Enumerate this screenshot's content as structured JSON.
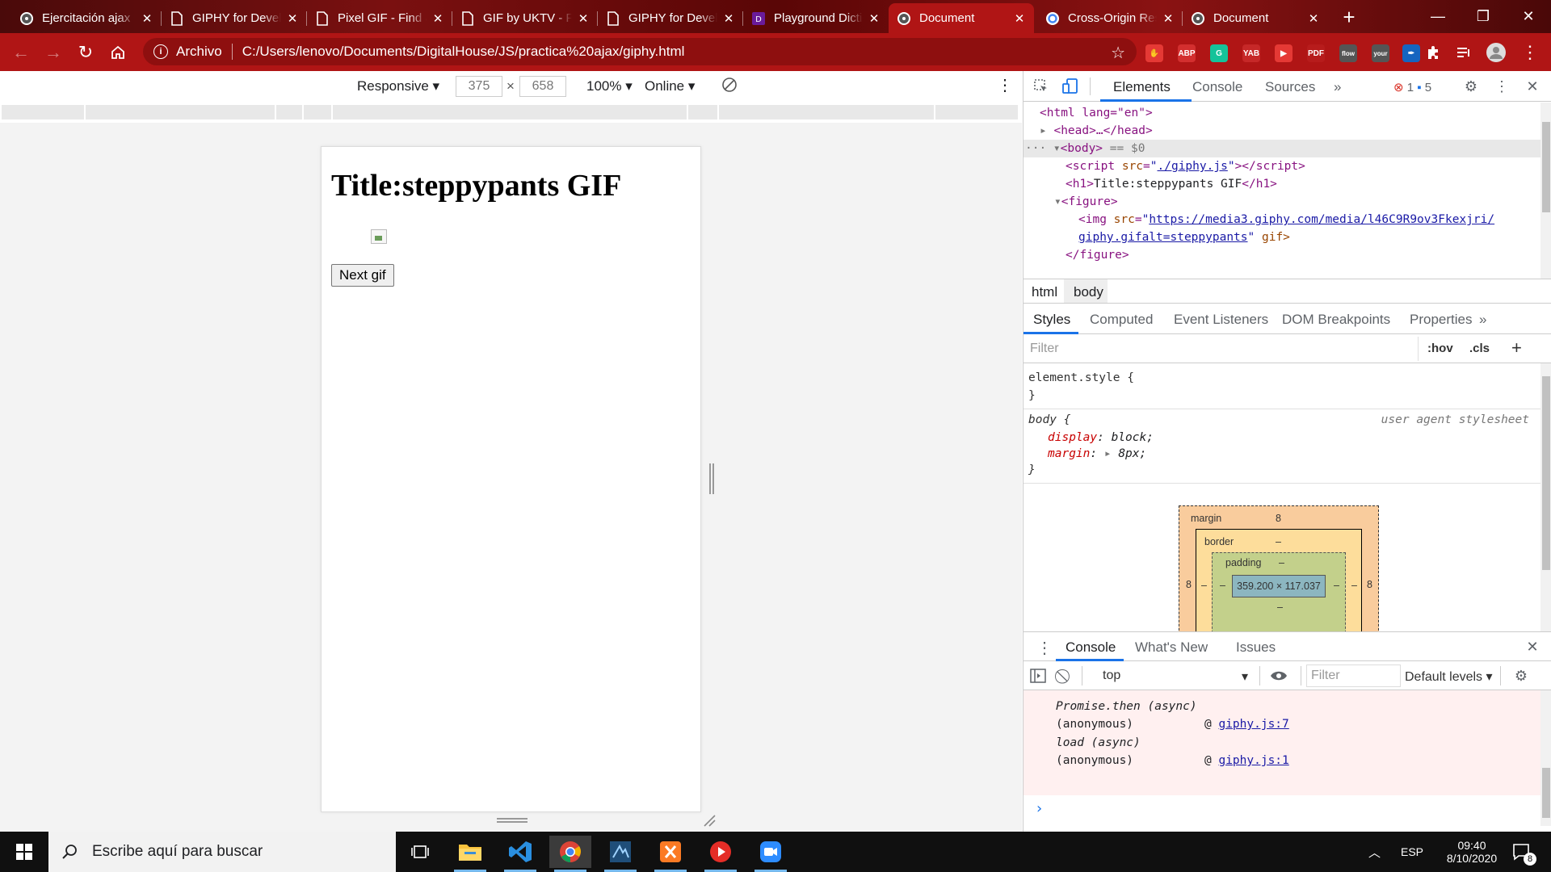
{
  "browser": {
    "tabs": [
      {
        "title": "Ejercitación ajax",
        "active": false
      },
      {
        "title": "GIPHY for Developers",
        "active": false
      },
      {
        "title": "Pixel GIF - Find & Share",
        "active": false
      },
      {
        "title": "GIF by UKTV - Find",
        "active": false
      },
      {
        "title": "GIPHY for Developers",
        "active": false
      },
      {
        "title": "Playground Dictionary",
        "active": false
      },
      {
        "title": "Document",
        "active": true
      },
      {
        "title": "Cross-Origin Resource",
        "active": false
      },
      {
        "title": "Document",
        "active": false
      }
    ],
    "address": {
      "scheme_label": "Archivo",
      "url": "C:/Users/lenovo/Documents/DigitalHouse/JS/practica%20ajax/giphy.html"
    },
    "extensions": [
      {
        "name": "stop-extension-icon",
        "label": "✋",
        "color": "#e53935"
      },
      {
        "name": "adblock-plus-icon",
        "label": "ABP",
        "color": "#d32f2f"
      },
      {
        "name": "grammarly-icon",
        "label": "G",
        "color": "#15c39a"
      },
      {
        "name": "yab-icon",
        "label": "YAB",
        "color": "#c62828"
      },
      {
        "name": "video-extension-icon",
        "label": "▶",
        "color": "#e53935"
      },
      {
        "name": "pdf-extension-icon",
        "label": "PDF",
        "color": "#b71c1c"
      },
      {
        "name": "flow-extension-icon",
        "label": "flow",
        "color": "#555555"
      },
      {
        "name": "your-extension-icon",
        "label": "your",
        "color": "#555555"
      },
      {
        "name": "pen-extension-icon",
        "label": "✒",
        "color": "#1565c0"
      }
    ]
  },
  "device_toolbar": {
    "mode": "Responsive",
    "width": "375",
    "height": "658",
    "times": "×",
    "zoom": "100%",
    "network": "Online"
  },
  "page": {
    "heading": "Title:steppypants GIF",
    "button_label": "Next gif"
  },
  "devtools": {
    "tabs": [
      "Elements",
      "Console",
      "Sources"
    ],
    "more": "»",
    "error_count": "1",
    "message_count": "5",
    "dom": {
      "html_open": "<html lang=\"en\">",
      "head": "<head>…</head>",
      "body_open": "<body>",
      "body_eq": "== $0",
      "script_src": "./giphy.js",
      "h1_text": "Title:steppypants GIF",
      "img_src_1": "https://media3.giphy.com/media/l46C9R9ov3Fkexjri/",
      "img_src_2": "giphy.gifalt=steppypants",
      "img_tail": "gif>",
      "figure_close": "</figure>"
    },
    "breadcrumbs": [
      "html",
      "body"
    ],
    "sub_tabs": [
      "Styles",
      "Computed",
      "Event Listeners",
      "DOM Breakpoints",
      "Properties"
    ],
    "filter_placeholder": "Filter",
    "hov": ":hov",
    "cls": ".cls",
    "styles": {
      "element_style": "element.style {",
      "close": "}",
      "body_selector": "body {",
      "source": "user agent stylesheet",
      "rules": [
        {
          "prop": "display",
          "value": "block;"
        },
        {
          "prop": "margin",
          "value": "8px;"
        }
      ]
    },
    "box_model": {
      "margin_label": "margin",
      "margin_value": "8",
      "border_label": "border",
      "padding_label": "padding",
      "dash": "–",
      "side_value": "8",
      "content": "359.200 × 117.037"
    },
    "drawer": {
      "tabs": [
        "Console",
        "What's New",
        "Issues"
      ],
      "context": "top",
      "filter_placeholder": "Filter",
      "levels": "Default levels",
      "messages": [
        {
          "text": "Promise.then (async)",
          "link": ""
        },
        {
          "text": "(anonymous)",
          "link": "giphy.js:7"
        },
        {
          "text": "load (async)",
          "link": ""
        },
        {
          "text": "(anonymous)",
          "link": "giphy.js:1"
        }
      ],
      "prompt": "›"
    }
  },
  "taskbar": {
    "search_placeholder": "Escribe aquí para buscar",
    "apps": [
      {
        "name": "task-view-icon"
      },
      {
        "name": "file-explorer-icon"
      },
      {
        "name": "vscode-icon"
      },
      {
        "name": "chrome-icon"
      },
      {
        "name": "tool-icon"
      },
      {
        "name": "xampp-icon"
      },
      {
        "name": "media-player-icon"
      },
      {
        "name": "zoom-icon"
      }
    ],
    "language": "ESP",
    "time": "09:40",
    "date": "8/10/2020",
    "notification_count": "8"
  }
}
